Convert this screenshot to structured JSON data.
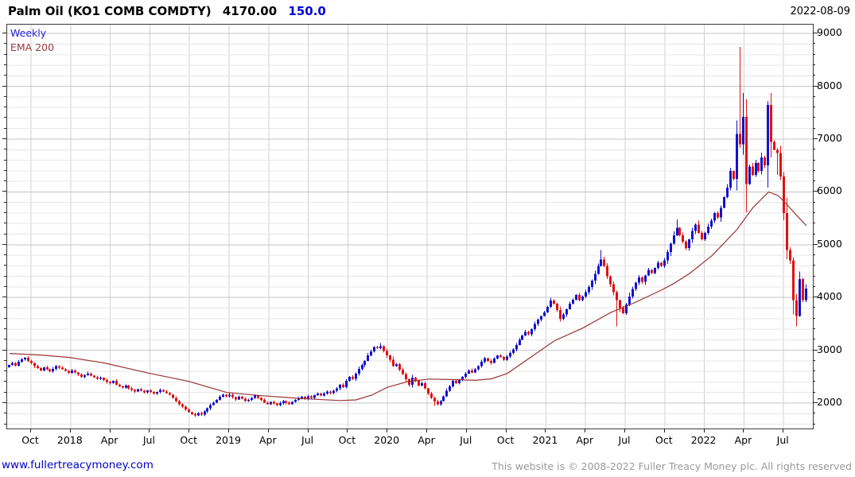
{
  "header": {
    "title": "Palm Oil (KO1 COMB COMDTY)",
    "last_price": "4170.00",
    "change": "150.0",
    "date": "2022-08-09"
  },
  "legend": {
    "series": "Weekly",
    "overlay": "EMA 200"
  },
  "footer": {
    "site_link": "www.fullertreacymoney.com",
    "copyright": "This website is © 2008-2022 Fuller Treacy Money plc. All rights reserved"
  },
  "colors": {
    "up_candle": "#1212cf",
    "down_candle": "#e01212",
    "ema_line": "#993333",
    "legend_weekly": "#2222cc",
    "legend_ema": "#9c3a3a",
    "change_text": "#0000dd",
    "link_text": "#0000c8",
    "copyright_text": "#9a9a9a",
    "grid_major": "#c6c6c6",
    "grid_minor": "#e7e7e7",
    "grid_vertical": "#d2d2d2",
    "plot_border": "#3a3a3a"
  },
  "chart_data": {
    "type": "candlestick",
    "title": "Palm Oil (KO1 COMB COMDTY)",
    "timeframe": "Weekly",
    "overlay": "EMA 200",
    "last_price": 4170.0,
    "change": 150.0,
    "as_of_date": "2022-08-09",
    "x_labels": [
      "Oct",
      "2018",
      "Apr",
      "Jul",
      "Oct",
      "2019",
      "Apr",
      "Jul",
      "Oct",
      "2020",
      "Apr",
      "Jul",
      "Oct",
      "2021",
      "Apr",
      "Jul",
      "Oct",
      "2022",
      "Apr",
      "Jul"
    ],
    "y_ticks": [
      2000,
      3000,
      4000,
      5000,
      6000,
      7000,
      8000,
      9000
    ],
    "y_minor_step": 200,
    "ylim": [
      1520,
      9170
    ],
    "grid": true,
    "legend_position": "top-left",
    "closes": [
      2720,
      2760,
      2710,
      2780,
      2830,
      2860,
      2800,
      2760,
      2700,
      2660,
      2620,
      2680,
      2640,
      2600,
      2650,
      2700,
      2670,
      2640,
      2610,
      2570,
      2620,
      2580,
      2540,
      2500,
      2530,
      2560,
      2520,
      2490,
      2460,
      2480,
      2440,
      2400,
      2380,
      2420,
      2350,
      2320,
      2290,
      2330,
      2280,
      2250,
      2220,
      2260,
      2230,
      2200,
      2240,
      2210,
      2180,
      2210,
      2250,
      2220,
      2190,
      2160,
      2100,
      2040,
      1980,
      1930,
      1880,
      1830,
      1790,
      1770,
      1810,
      1780,
      1840,
      1900,
      1960,
      2010,
      2060,
      2120,
      2160,
      2130,
      2160,
      2110,
      2070,
      2120,
      2080,
      2040,
      2060,
      2100,
      2140,
      2100,
      2060,
      2010,
      1980,
      2020,
      1990,
      1960,
      2000,
      2040,
      2010,
      1980,
      2020,
      2060,
      2090,
      2120,
      2080,
      2130,
      2100,
      2150,
      2180,
      2140,
      2180,
      2220,
      2190,
      2230,
      2280,
      2350,
      2300,
      2420,
      2500,
      2460,
      2560,
      2650,
      2720,
      2800,
      2900,
      2980,
      3060,
      3040,
      3080,
      2990,
      2900,
      2820,
      2700,
      2740,
      2630,
      2550,
      2450,
      2350,
      2480,
      2430,
      2330,
      2380,
      2280,
      2180,
      2100,
      2030,
      1980,
      2040,
      2130,
      2230,
      2320,
      2420,
      2380,
      2440,
      2500,
      2560,
      2620,
      2580,
      2640,
      2700,
      2780,
      2850,
      2800,
      2760,
      2840,
      2900,
      2870,
      2820,
      2880,
      2950,
      3020,
      3100,
      3200,
      3280,
      3350,
      3300,
      3400,
      3500,
      3580,
      3650,
      3720,
      3820,
      3940,
      3880,
      3760,
      3600,
      3680,
      3780,
      3880,
      3960,
      4050,
      3950,
      4020,
      4100,
      4200,
      4320,
      4450,
      4600,
      4720,
      4600,
      4400,
      4250,
      4100,
      3950,
      3800,
      3700,
      3870,
      4020,
      4160,
      4280,
      4380,
      4300,
      4420,
      4520,
      4460,
      4560,
      4660,
      4600,
      4700,
      4860,
      5020,
      5180,
      5320,
      5180,
      5060,
      4940,
      5100,
      5260,
      5380,
      5220,
      5100,
      5220,
      5340,
      5460,
      5600,
      5520,
      5700,
      5900,
      6080,
      6400,
      6250,
      7100,
      6900,
      7420,
      6150,
      6480,
      6320,
      6550,
      6400,
      6650,
      6500,
      7650,
      6950,
      6800,
      6740,
      6290,
      5600,
      4900,
      4700,
      3950,
      3650,
      4350,
      3950,
      4170
    ],
    "wick_overrides": {
      "59": {
        "low": 1740
      },
      "118": {
        "high": 3140
      },
      "135": {
        "low": 1945
      },
      "188": {
        "high": 4900
      },
      "193": {
        "low": 3450
      },
      "212": {
        "high": 5480
      },
      "232": {
        "high": 8750
      },
      "233": {
        "high": 7870
      },
      "241": {
        "high": 7720
      },
      "244": {
        "low": 6320
      },
      "250": {
        "low": 3450
      }
    },
    "ema_points": [
      [
        0,
        2940
      ],
      [
        10,
        2910
      ],
      [
        19,
        2865
      ],
      [
        30,
        2760
      ],
      [
        44,
        2570
      ],
      [
        57,
        2410
      ],
      [
        69,
        2200
      ],
      [
        80,
        2140
      ],
      [
        93,
        2085
      ],
      [
        105,
        2048
      ],
      [
        110,
        2060
      ],
      [
        115,
        2150
      ],
      [
        120,
        2300
      ],
      [
        126,
        2400
      ],
      [
        133,
        2455
      ],
      [
        141,
        2445
      ],
      [
        148,
        2430
      ],
      [
        153,
        2460
      ],
      [
        158,
        2560
      ],
      [
        166,
        2890
      ],
      [
        173,
        3180
      ],
      [
        182,
        3420
      ],
      [
        191,
        3720
      ],
      [
        198,
        3890
      ],
      [
        207,
        4140
      ],
      [
        211,
        4270
      ],
      [
        216,
        4460
      ],
      [
        223,
        4790
      ],
      [
        231,
        5290
      ],
      [
        236,
        5700
      ],
      [
        241,
        6000
      ],
      [
        244,
        5930
      ],
      [
        247,
        5750
      ],
      [
        250,
        5550
      ],
      [
        253,
        5360
      ]
    ]
  }
}
